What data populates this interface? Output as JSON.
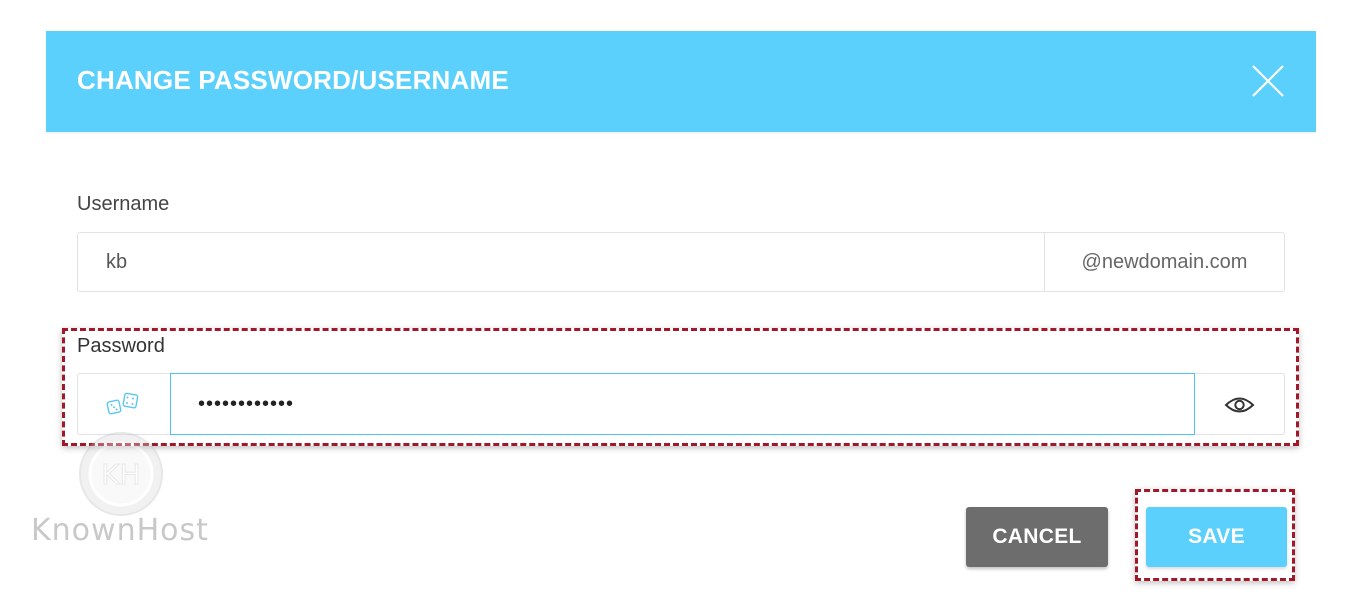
{
  "colors": {
    "accent": "#5bd0fd",
    "highlight": "#a2182b",
    "cancel_button": "#6d6d6d"
  },
  "modal": {
    "title": "CHANGE PASSWORD/USERNAME",
    "close_icon": "close-x-icon"
  },
  "username": {
    "label": "Username",
    "value": "kb",
    "domain_suffix": "@newdomain.com"
  },
  "password": {
    "label": "Password",
    "value": "••••••••••••",
    "generate_icon": "dice-icon",
    "reveal_icon": "eye-icon"
  },
  "buttons": {
    "cancel_label": "CANCEL",
    "save_label": "SAVE"
  },
  "watermark": {
    "logo_letters": "KH",
    "text": "KnownHost"
  }
}
